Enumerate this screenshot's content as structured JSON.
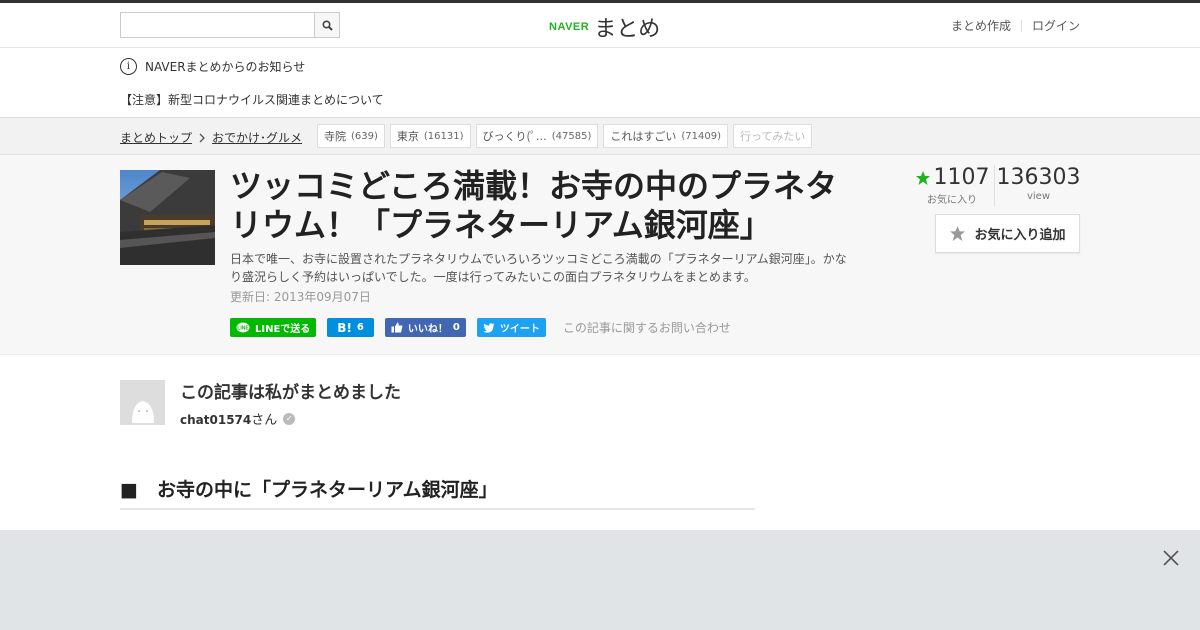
{
  "header": {
    "logo_naver": "NAVER",
    "logo_matome": "まとめ",
    "create_link": "まとめ作成",
    "login_link": "ログイン"
  },
  "notice": {
    "heading": "NAVERまとめからのお知らせ",
    "item": "【注意】新型コロナウイルス関連まとめについて"
  },
  "breadcrumb": {
    "home": "まとめトップ",
    "category": "おでかけ･グルメ"
  },
  "tags": [
    {
      "label": "寺院",
      "count": "(639)"
    },
    {
      "label": "東京",
      "count": "(16131)"
    },
    {
      "label": "びっくり(ﾟ…",
      "count": "(47585)"
    },
    {
      "label": "これはすごい",
      "count": "(71409)"
    },
    {
      "label": "行ってみたい",
      "count": ""
    }
  ],
  "article": {
    "title": "ツッコミどころ満載！お寺の中のプラネタリウム！「プラネターリアム銀河座」",
    "description": "日本で唯一、お寺に設置されたプラネタリウムでいろいろツッコミどころ満載の「プラネターリアム銀河座」。かなり盛況らしく予約はいっぱいでした。一度は行ってみたいこの面白プラネタリウムをまとめます。",
    "updated": "更新日: 2013年09月07日"
  },
  "share": {
    "line": "LINEで送る",
    "hatena_count": "6",
    "fb_like": "いいね！",
    "fb_count": "0",
    "tweet": "ツイート",
    "contact": "この記事に関するお問い合わせ"
  },
  "stats": {
    "favorites": "1107",
    "favorites_label": "お気に入り",
    "views": "136303",
    "views_label": "view",
    "fav_add_label": "お気に入り追加"
  },
  "author": {
    "heading": "この記事は私がまとめました",
    "name": "chat01574",
    "suffix": "さん"
  },
  "section": {
    "heading": "■　お寺の中に「プラネターリアム銀河座」"
  },
  "colors": {
    "brand_green": "#21b321",
    "line_green": "#00b900",
    "hatena_blue": "#008fde",
    "fb_blue": "#4267b2",
    "twitter_blue": "#1da1f2"
  }
}
